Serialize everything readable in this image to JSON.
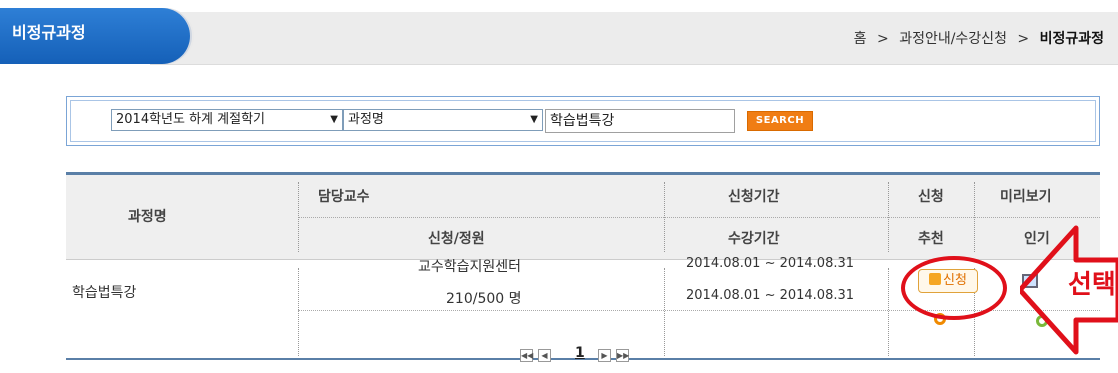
{
  "header": {
    "title": "비정규과정",
    "breadcrumb": {
      "home": "홈",
      "sep": ">",
      "section": "과정안내/수강신청",
      "current": "비정규과정"
    }
  },
  "search": {
    "term_select": "2014학년도 하계 계절학기",
    "field_select": "과정명",
    "keyword": "학습법특강",
    "button_label": "SEARCH"
  },
  "table": {
    "headers": {
      "course_name": "과정명",
      "professor": "담당교수",
      "apply_period": "신청기간",
      "apply": "신청",
      "preview": "미리보기",
      "applied_capacity": "신청/정원",
      "study_period": "수강기간",
      "recommend": "추천",
      "popular": "인기"
    },
    "rows": [
      {
        "course_name": "학습법특강",
        "professor": "교수학습지원센터",
        "applied_capacity": "210/500 명",
        "apply_period": "2014.08.01 ~ 2014.08.31",
        "study_period": "2014.08.01 ~ 2014.08.31",
        "apply_button": "신청"
      }
    ]
  },
  "pager": {
    "current_page": "1"
  },
  "annotation": {
    "label": "선택"
  },
  "colors": {
    "accent": "#1560b8",
    "annotation": "#e0101a",
    "search_button": "#f07d14"
  }
}
